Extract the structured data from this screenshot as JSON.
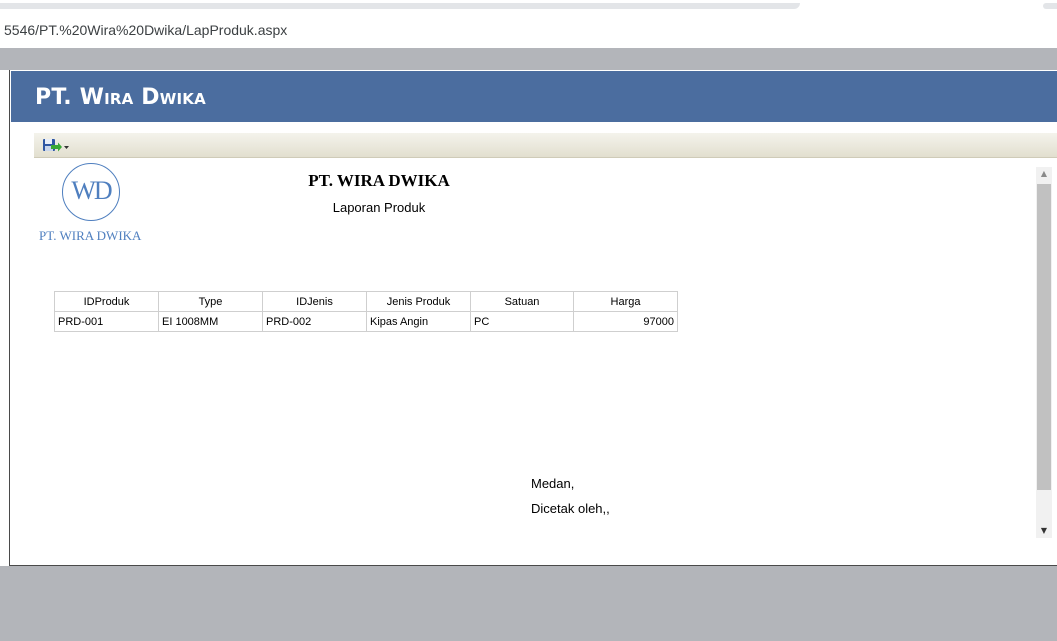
{
  "browser": {
    "url": "5546/PT.%20Wira%20Dwika/LapProduk.aspx"
  },
  "header": {
    "brand": "PT. Wira Dwika"
  },
  "toolbar": {
    "save_icon": "save-disk-icon",
    "dropdown_icon": "chevron-down-icon"
  },
  "report": {
    "logo_initials": "WD",
    "logo_name": "PT. WIRA DWIKA",
    "title": "PT. WIRA DWIKA",
    "subtitle": "Laporan Produk",
    "table": {
      "headers": [
        "IDProduk",
        "Type",
        "IDJenis",
        "Jenis Produk",
        "Satuan",
        "Harga"
      ],
      "rows": [
        [
          "PRD-001",
          "EI 1008MM",
          "PRD-002",
          "Kipas Angin",
          "PC",
          "97000"
        ]
      ]
    },
    "place": "Medan,",
    "printed_by": "Dicetak oleh,,"
  },
  "colors": {
    "header_bg": "#4b6d9f",
    "logo_blue": "#4f7fbf",
    "outer_gray": "#b3b5ba"
  }
}
